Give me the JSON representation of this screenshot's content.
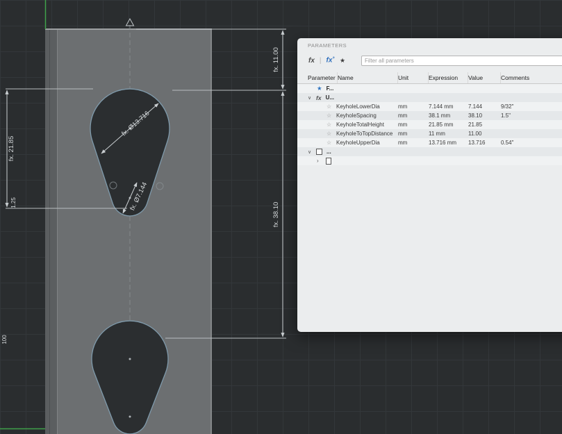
{
  "viewport": {
    "axis_color": "#3fa24a",
    "sketch_color": "#7f9aab",
    "dimension_color": "#d6dadc",
    "dimensions": {
      "keyhole_to_top": "fx. 11.00",
      "keyhole_total_height": "fx. 21.85",
      "keyhole_spacing": "fx. 38.10",
      "keyhole_upper_dia": "fx. Ø13.716",
      "keyhole_lower_dia": "fx. Ø7.144",
      "edge_dim": "1.25",
      "plate_length": "100"
    }
  },
  "panel": {
    "title": "PARAMETERS",
    "toolbar": {
      "fx_icon": "fx",
      "fx_add_icon": "fx",
      "fx_add_plus": "+",
      "star_icon": "★"
    },
    "filter_placeholder": "Filter all parameters",
    "columns": [
      "Parameter",
      "Name",
      "Unit",
      "Expression",
      "Value",
      "Comments"
    ],
    "groups": {
      "favorites": {
        "label": "F...",
        "icon": "★"
      },
      "user": {
        "label": "U...",
        "icon": "fx",
        "caret": "∨"
      },
      "model": {
        "label": "...",
        "caret": "∨"
      },
      "model_child_caret": "›"
    },
    "row_star": "☆",
    "rows": [
      {
        "name": "KeyholeLowerDia",
        "unit": "mm",
        "expression": "7.144 mm",
        "value": "7.144",
        "comment": "9/32\""
      },
      {
        "name": "KeyholeSpacing",
        "unit": "mm",
        "expression": "38.1 mm",
        "value": "38.10",
        "comment": "1.5\""
      },
      {
        "name": "KeyholeTotalHeight",
        "unit": "mm",
        "expression": "21.85 mm",
        "value": "21.85",
        "comment": ""
      },
      {
        "name": "KeyholeToTopDistance",
        "unit": "mm",
        "expression": "11 mm",
        "value": "11.00",
        "comment": ""
      },
      {
        "name": "KeyholeUpperDia",
        "unit": "mm",
        "expression": "13.716 mm",
        "value": "13.716",
        "comment": "0.54\""
      }
    ]
  }
}
